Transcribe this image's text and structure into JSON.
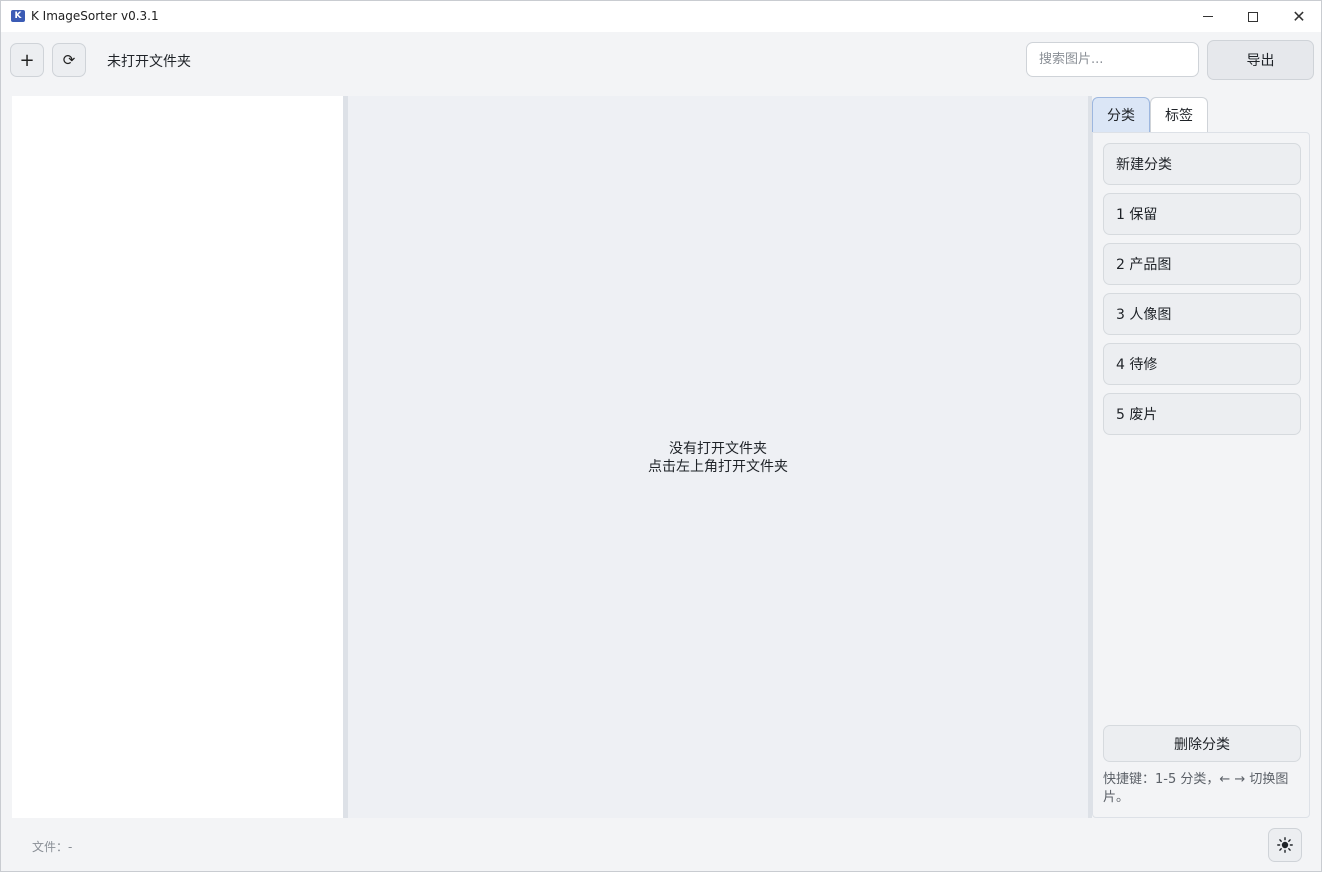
{
  "window": {
    "title": "K ImageSorter v0.3.1",
    "icon_letter": "K",
    "close_glyph": "✕"
  },
  "toolbar": {
    "add_glyph": "+",
    "refresh_glyph": "⟳",
    "folder_status": "未打开文件夹",
    "search_placeholder": "搜索图片...",
    "search_value": "",
    "export_label": "导出"
  },
  "viewer": {
    "empty_line1": "没有打开文件夹",
    "empty_line2": "点击左上角打开文件夹"
  },
  "sidebar": {
    "tabs": [
      {
        "label": "分类",
        "active": true
      },
      {
        "label": "标签",
        "active": false
      }
    ],
    "new_category_label": "新建分类",
    "categories": [
      {
        "label": "1 保留"
      },
      {
        "label": "2 产品图"
      },
      {
        "label": "3 人像图"
      },
      {
        "label": "4 待修"
      },
      {
        "label": "5 废片"
      }
    ],
    "delete_label": "删除分类",
    "hint": "快捷键：1-5 分类，← → 切换图片。"
  },
  "statusbar": {
    "file_label": "文件：-",
    "theme_icon": "sun-icon"
  },
  "colors": {
    "accent_tab_bg": "#dbe6f6",
    "viewer_bg": "#eef0f4",
    "window_bg": "#f3f4f6"
  }
}
